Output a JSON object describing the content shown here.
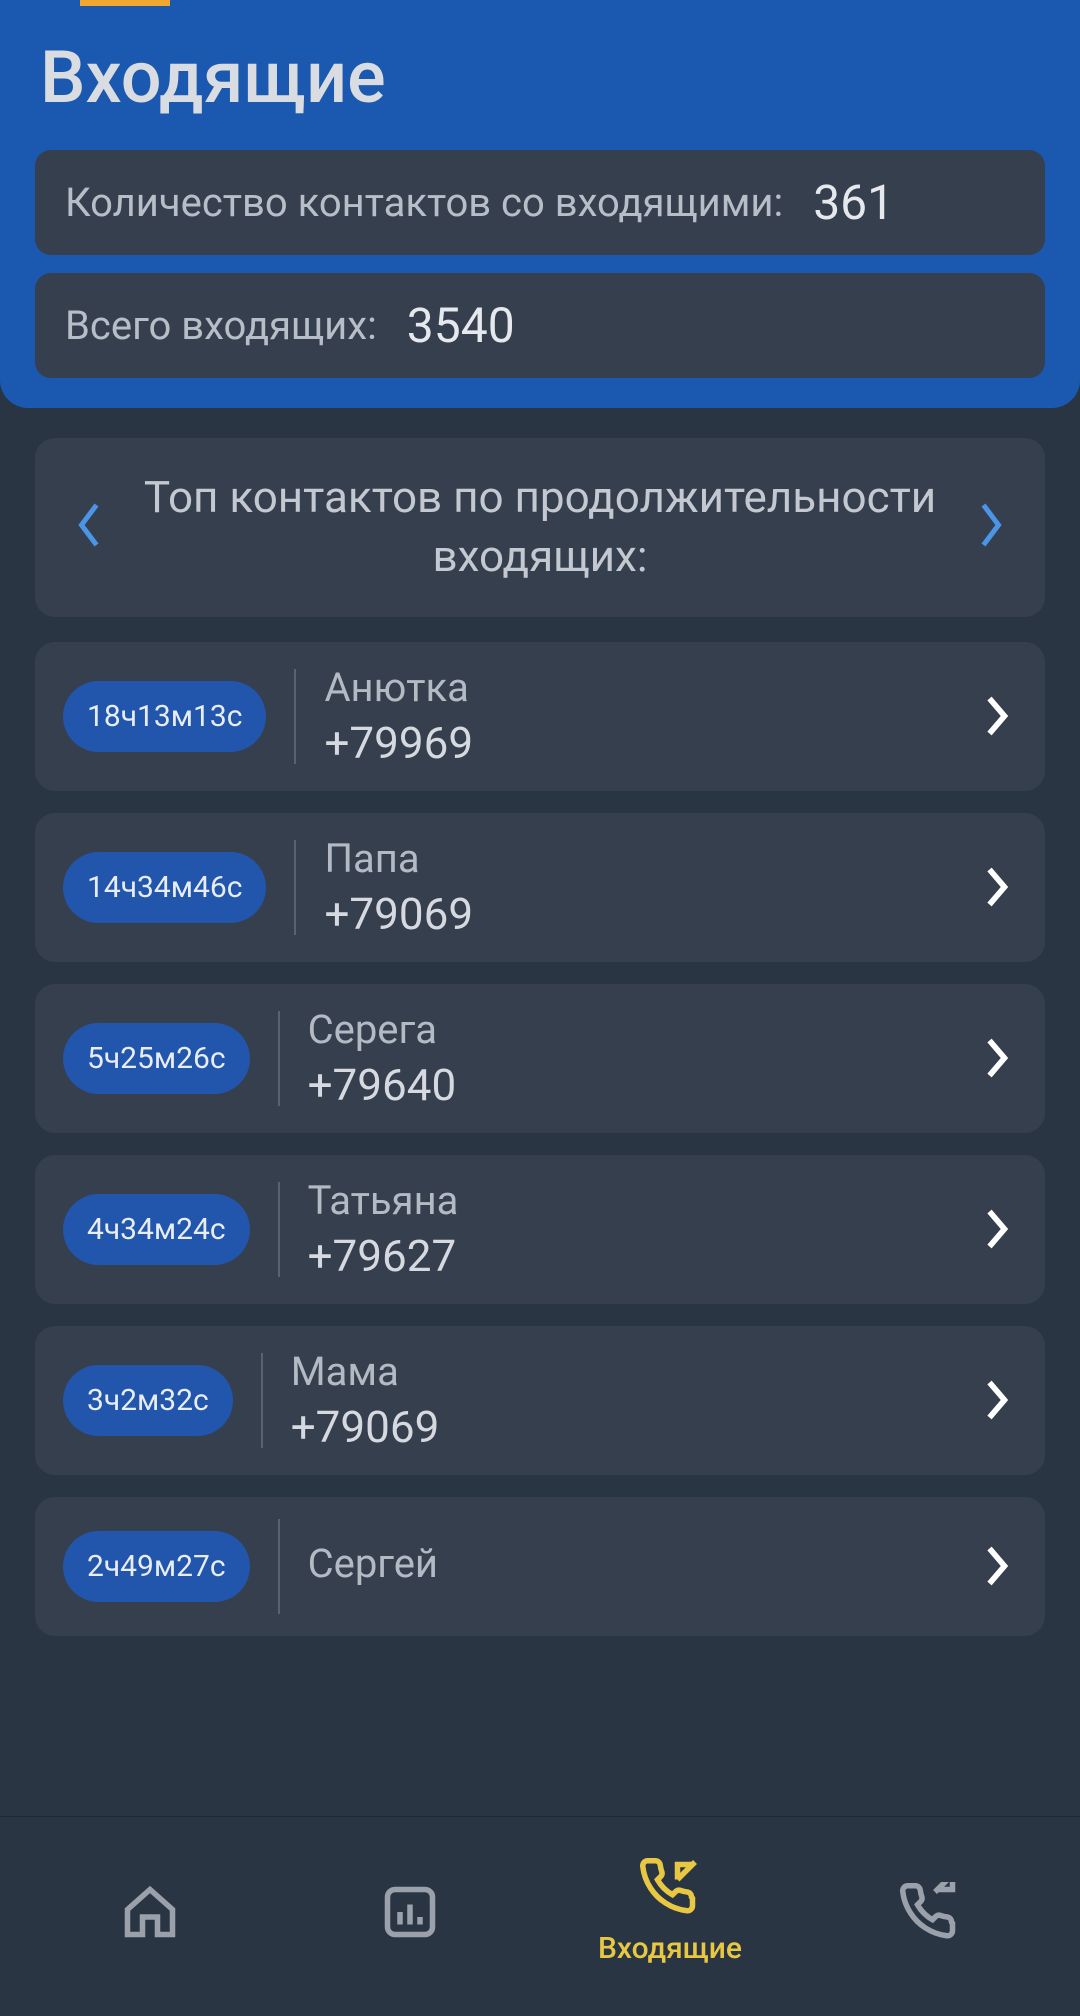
{
  "header": {
    "title": "Входящие",
    "stats": [
      {
        "label": "Количество контактов со входящими:",
        "value": "361"
      },
      {
        "label": "Всего входящих:",
        "value": "3540"
      }
    ]
  },
  "carousel": {
    "title": "Топ контактов по продолжительности входящих:"
  },
  "contacts": [
    {
      "duration": "18ч13м13с",
      "name": "Анютка",
      "phone": "+79969"
    },
    {
      "duration": "14ч34м46с",
      "name": "Папа",
      "phone": "+79069"
    },
    {
      "duration": "5ч25м26с",
      "name": "Серега",
      "phone": "+79640"
    },
    {
      "duration": "4ч34м24с",
      "name": "Татьяна",
      "phone": "+79627"
    },
    {
      "duration": "3ч2м32с",
      "name": "Мама",
      "phone": "+79069"
    },
    {
      "duration": "2ч49м27с",
      "name": "Сергей",
      "phone": ""
    }
  ],
  "nav": {
    "active_label": "Входящие"
  },
  "colors": {
    "accent_blue": "#1b58b0",
    "pill_blue": "#2156ac",
    "bg": "#2a3544",
    "card": "#363f4e",
    "active_yellow": "#e8c843"
  }
}
